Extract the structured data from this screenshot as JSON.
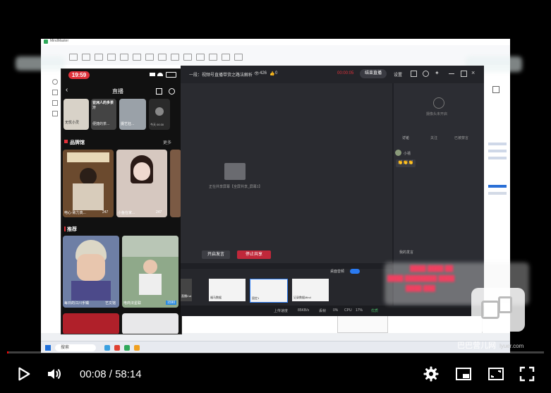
{
  "player": {
    "time_current": "00:08",
    "time_separator": " / ",
    "time_total": "58:14",
    "progress_fraction": 0.0023,
    "accent_color": "#ff0000"
  },
  "desktop": {
    "app_title": "MindMaster",
    "search_label": "搜索"
  },
  "phone": {
    "time": "19:59",
    "tab_title": "直播",
    "top_items": [
      "无忧小灵",
      "亚洲人的多茶汁",
      "便捷的茶...",
      "摄艺狂..."
    ],
    "top_right_item": "今天 00:30",
    "section_brand": "品牌馆",
    "section_more": "更多",
    "section_recommend": "推荐",
    "brand_cards": [
      {
        "caption": "电心·致力真...",
        "count": "247"
      },
      {
        "caption": "小鱼在家...",
        "count": "247"
      }
    ],
    "recommend_cards": [
      {
        "caption": "每日的江川手镯",
        "count": "艺文馆"
      },
      {
        "caption": "电商法星联",
        "count": "1590"
      }
    ]
  },
  "live": {
    "title": "一段：视频号直播带货之路法解析",
    "viewers": "426",
    "likes": "0",
    "timer": "00:00:05",
    "end_button": "结束直播",
    "settings_label": "设置",
    "share_hint": "正在共享屏幕【全屏共享_屏幕1】",
    "start_speaking": "开启发言",
    "stop_share": "停止共享",
    "camera_hint": "摄像头未开启",
    "tabs": [
      "讨论",
      "关注",
      "已被禁言"
    ],
    "chat_user": "小禧",
    "chat_emojis": "👏👏👏",
    "my_chat": "我的发言",
    "mic_label": "桌面音频",
    "status_upload": "上传速度",
    "status_upload_val": "85KB/s",
    "status_loss": "丢帧",
    "status_loss_val": "0%",
    "status_cpu": "CPU",
    "status_cpu_val": "17%",
    "status_quality": "优质",
    "strip_items": [
      "直播Cut",
      "福马数据",
      "固定1",
      "记录数据Mind"
    ],
    "send_label": "发送"
  },
  "watermark": {
    "site": "巴巴营儿网",
    "domain": "lyuer.com"
  }
}
